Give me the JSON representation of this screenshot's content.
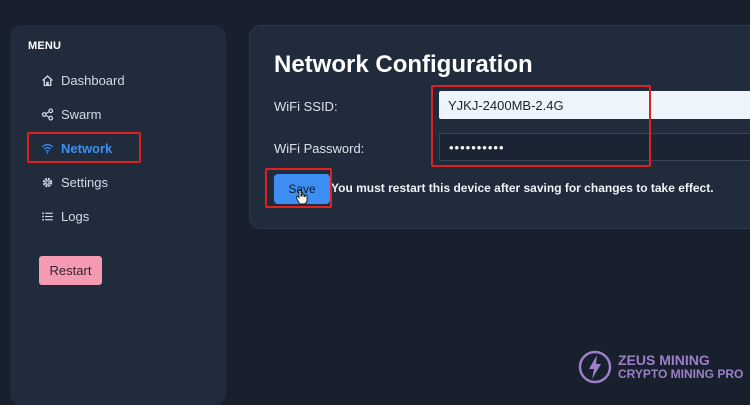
{
  "sidebar": {
    "menu_title": "MENU",
    "items": [
      {
        "label": "Dashboard",
        "icon": "home-icon"
      },
      {
        "label": "Swarm",
        "icon": "share-icon"
      },
      {
        "label": "Network",
        "icon": "wifi-icon",
        "active": true
      },
      {
        "label": "Settings",
        "icon": "gear-icon"
      },
      {
        "label": "Logs",
        "icon": "list-icon"
      }
    ],
    "restart_label": "Restart"
  },
  "main": {
    "title": "Network Configuration",
    "wifi_ssid_label": "WiFi SSID:",
    "wifi_ssid_value": "YJKJ-2400MB-2.4G",
    "wifi_password_label": "WiFi Password:",
    "wifi_password_value": "••••••••••",
    "save_label": "Save",
    "restart_hint": "You must restart this device after saving for changes to take effect."
  },
  "watermark": {
    "line1": "ZEUS MINING",
    "line2": "CRYPTO MINING PRO"
  },
  "colors": {
    "accent": "#3d8ef0",
    "highlight": "#e0211f",
    "restart": "#f49ab3"
  }
}
